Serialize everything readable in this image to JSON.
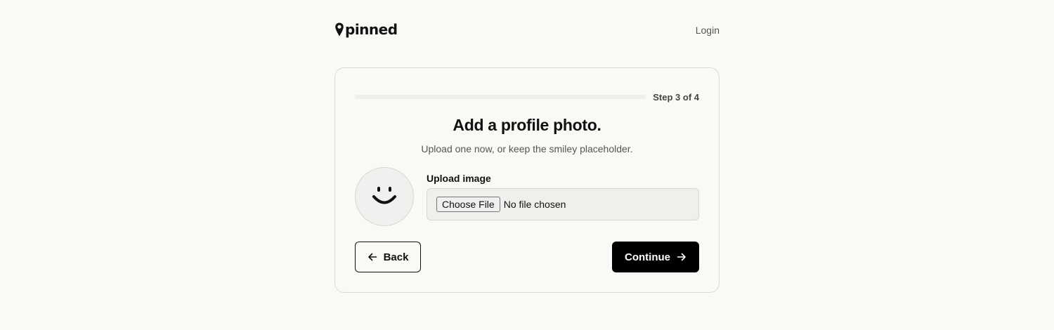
{
  "app": {
    "logo_text": "pinned",
    "logo_icon": "map-pin-icon"
  },
  "header": {
    "login_label": "Login"
  },
  "progress": {
    "step_label": "Step 3 of 4",
    "current_step": 3,
    "total_steps": 4
  },
  "content": {
    "title": "Add a profile photo.",
    "subtitle": "Upload one now, or keep the smiley placeholder."
  },
  "avatar": {
    "icon": "smiley-face-icon"
  },
  "upload": {
    "label": "Upload image",
    "button_label": "Choose File",
    "status": "No file chosen"
  },
  "actions": {
    "back_label": "Back",
    "back_icon": "arrow-left-icon",
    "continue_label": "Continue",
    "continue_icon": "arrow-right-icon"
  },
  "colors": {
    "background": "#faf9f6",
    "primary_button": "#000000",
    "text": "#111111",
    "muted_text": "#555555",
    "border": "#dcdad6"
  }
}
